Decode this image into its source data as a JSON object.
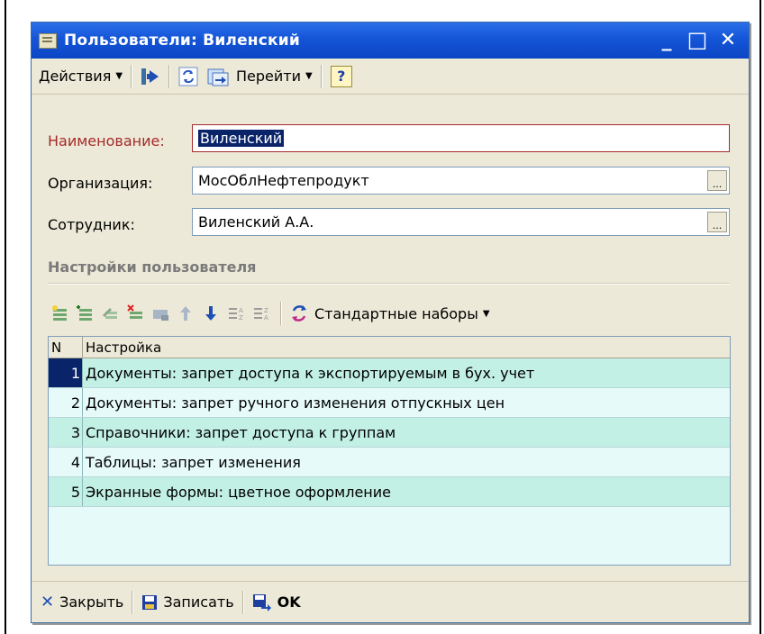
{
  "window": {
    "title": "Пользователи: Виленский",
    "minimize": "_",
    "maximize": "□",
    "close": "✕"
  },
  "toolbar": {
    "actions_label": "Действия",
    "goto_label": "Перейти",
    "help_label": "?"
  },
  "form": {
    "name_label": "Наименование:",
    "name_value": "Виленский",
    "org_label": "Организация:",
    "org_value": "МосОблНефтепродукт",
    "employee_label": "Сотрудник:",
    "employee_value": "Виленский А.А.",
    "select_button": "..."
  },
  "section": {
    "title": "Настройки пользователя"
  },
  "grid_toolbar": {
    "standard_sets_label": "Стандартные наборы"
  },
  "grid": {
    "headers": [
      "N",
      "Настройка"
    ],
    "rows": [
      {
        "n": "1",
        "setting": "Документы: запрет доступа к экспортируемым в бух. учет"
      },
      {
        "n": "2",
        "setting": "Документы: запрет ручного изменения отпускных цен"
      },
      {
        "n": "3",
        "setting": "Справочники: запрет доступа к группам"
      },
      {
        "n": "4",
        "setting": "Таблицы: запрет изменения"
      },
      {
        "n": "5",
        "setting": "Экранные формы: цветное оформление"
      }
    ]
  },
  "bottombar": {
    "close_label": "Закрыть",
    "save_label": "Записать",
    "ok_label": "OK"
  },
  "colors": {
    "title_bar": "#1455d8",
    "window_bg": "#ece9d8",
    "row_alt": "#c2f0e4",
    "row_base": "#e6fafa",
    "selection": "#0a246a",
    "required_label": "#a52a2a"
  }
}
